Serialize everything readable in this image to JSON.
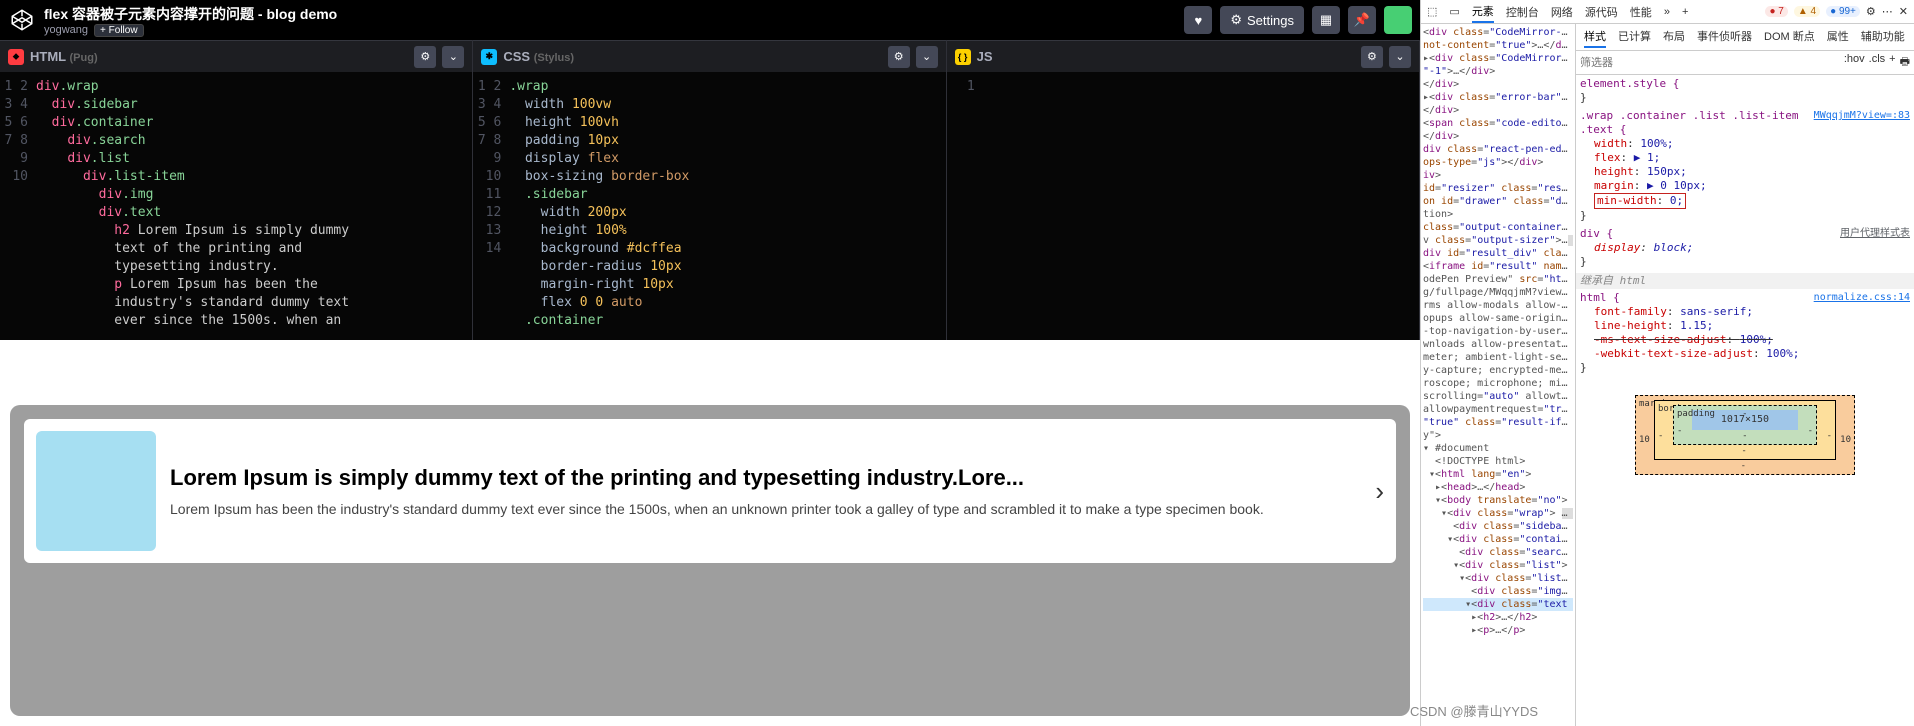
{
  "header": {
    "title": "flex 容器被子元素内容撑开的问题 - blog demo",
    "author": "yogwang",
    "follow": "+ Follow",
    "settings": "Settings",
    "settings_icon": "⚙"
  },
  "editors": {
    "html": {
      "label": "HTML",
      "sub": "(Pug)"
    },
    "css": {
      "label": "CSS",
      "sub": "(Stylus)"
    },
    "js": {
      "label": "JS",
      "sub": ""
    },
    "html_gutter": "1\n2\n3\n4\n5\n6\n7\n8\n9\n\n\n10\n\n",
    "css_gutter": "1\n2\n3\n4\n5\n6\n7\n8\n9\n10\n11\n12\n13\n14"
  },
  "preview": {
    "h2": "Lorem Ipsum is simply dummy text of the printing and typesetting industry.Lore...",
    "p": "Lorem Ipsum has been the industry's standard dummy text ever since the 1500s, when an unknown printer took a galley of type and scrambled it to make a type specimen book."
  },
  "devtools": {
    "topTabs": [
      "元素",
      "控制台",
      "网络",
      "源代码",
      "性能",
      "»",
      "+"
    ],
    "errors": "7",
    "warnings": "4",
    "info": "99+",
    "styleTabs": [
      "样式",
      "已计算",
      "布局",
      "事件侦听器",
      "DOM 断点",
      "属性",
      "辅助功能"
    ],
    "filter_ph": "筛选器",
    "hov": ":hov",
    "cls": ".cls",
    "plus": "+",
    "box": {
      "content": "1017×150",
      "pl": "-",
      "pr": "-",
      "bl": "-",
      "br": "-",
      "ml": "10",
      "mr": "10"
    },
    "rules": {
      "r0_sel": "element.style {",
      "r1_sel": ".wrap .container .list .list-item .text {",
      "r1_src": "MWqqjmM?view=:83",
      "r1_p": [
        {
          "n": "width",
          "v": "100%;"
        },
        {
          "n": "flex",
          "v": "▶ 1;"
        },
        {
          "n": "height",
          "v": "150px;"
        },
        {
          "n": "margin",
          "v": "▶ 0 10px;"
        },
        {
          "n": "min-width",
          "v": "0;",
          "hl": true
        }
      ],
      "r2_sel": "div {",
      "r2_src": "用户代理样式表",
      "r2_p": [
        {
          "n": "display",
          "v": "block;",
          "it": true
        }
      ],
      "inh": "继承自 html",
      "r3_sel": "html {",
      "r3_src": "normalize.css:14",
      "r3_p": [
        {
          "n": "font-family",
          "v": "sans-serif;"
        },
        {
          "n": "line-height",
          "v": "1.15;"
        },
        {
          "n": "-ms-text-size-adjust",
          "v": "100%;",
          "st": true
        },
        {
          "n": "-webkit-text-size-adjust",
          "v": "100%;"
        }
      ]
    }
  },
  "watermark": "CSDN @滕青山YYDS"
}
